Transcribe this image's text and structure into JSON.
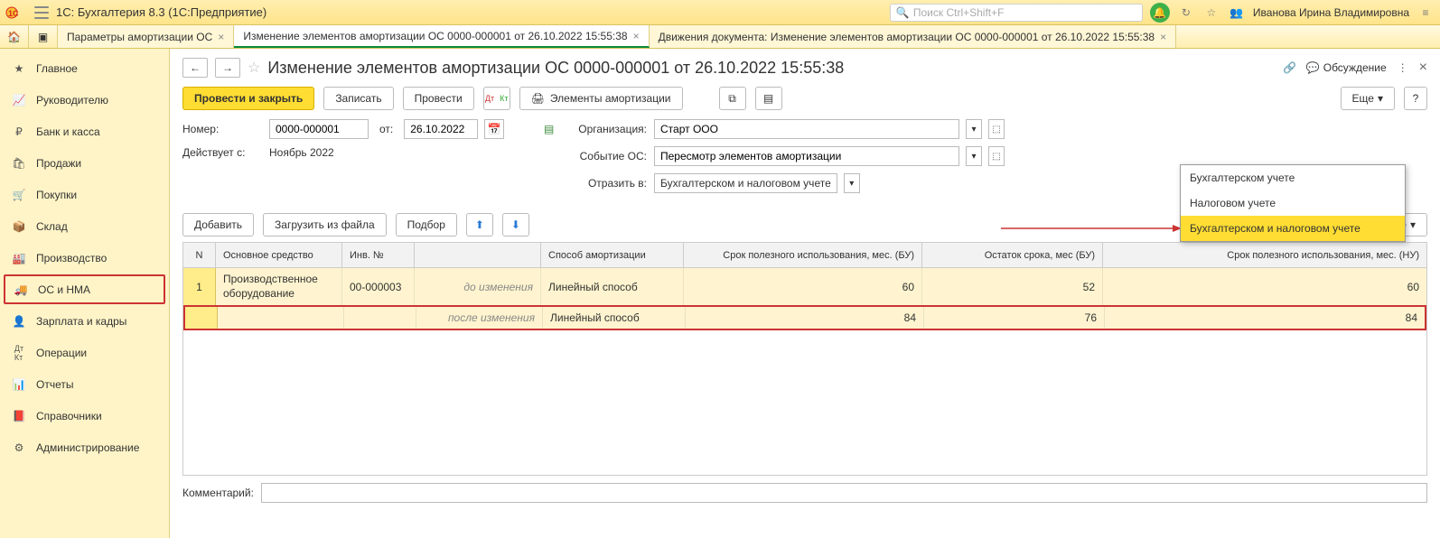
{
  "app": {
    "title": "1С: Бухгалтерия 8.3  (1С:Предприятие)",
    "search_placeholder": "Поиск Ctrl+Shift+F",
    "user": "Иванова Ирина Владимировна"
  },
  "tabs": {
    "t1": "Параметры амортизации ОС",
    "t2": "Изменение элементов амортизации ОС 0000-000001 от 26.10.2022 15:55:38",
    "t3": "Движения документа: Изменение элементов амортизации ОС 0000-000001 от 26.10.2022 15:55:38"
  },
  "sidebar": {
    "items": [
      "Главное",
      "Руководителю",
      "Банк и касса",
      "Продажи",
      "Покупки",
      "Склад",
      "Производство",
      "ОС и НМА",
      "Зарплата и кадры",
      "Операции",
      "Отчеты",
      "Справочники",
      "Администрирование"
    ]
  },
  "page": {
    "title": "Изменение элементов амортизации ОС 0000-000001 от 26.10.2022 15:55:38",
    "discuss": "Обсуждение"
  },
  "toolbar": {
    "post_close": "Провести и закрыть",
    "write": "Записать",
    "post": "Провести",
    "elements": "Элементы амортизации",
    "more": "Еще"
  },
  "form": {
    "number_label": "Номер:",
    "number": "0000-000001",
    "from_label": "от:",
    "date": "26.10.2022",
    "org_label": "Организация:",
    "org": "Старт ООО",
    "valid_label": "Действует с:",
    "valid": "Ноябрь 2022",
    "event_label": "Событие ОС:",
    "event": "Пересмотр элементов амортизации",
    "reflect_label": "Отразить в:",
    "reflect": "Бухгалтерском и налоговом учете"
  },
  "table_toolbar": {
    "add": "Добавить",
    "load": "Загрузить из файла",
    "pick": "Подбор",
    "more": "Еще"
  },
  "grid": {
    "headers": {
      "n": "N",
      "os": "Основное средство",
      "inv": "Инв. №",
      "chg": "",
      "method": "Способ амортизации",
      "bu": "Срок полезного использования, мес. (БУ)",
      "rem": "Остаток срока, мес (БУ)",
      "nu": "Срок полезного использования, мес. (НУ)"
    },
    "row": {
      "n": "1",
      "os": "Производственное оборудование",
      "inv": "00-000003",
      "before_label": "до изменения",
      "before_method": "Линейный способ",
      "before_bu": "60",
      "before_rem": "52",
      "before_nu": "60",
      "after_label": "после изменения",
      "after_method": "Линейный способ",
      "after_bu": "84",
      "after_rem": "76",
      "after_nu": "84"
    }
  },
  "comment_label": "Комментарий:",
  "popup": {
    "opt1": "Бухгалтерском учете",
    "opt2": "Налоговом учете",
    "opt3": "Бухгалтерском и налоговом учете"
  }
}
